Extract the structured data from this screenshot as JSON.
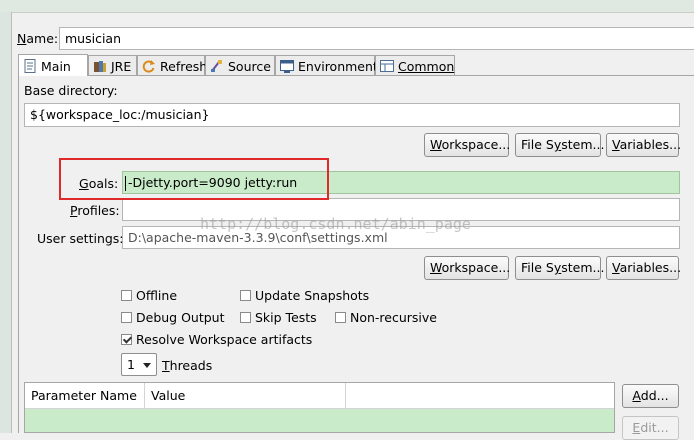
{
  "name_field": {
    "label": "Name:",
    "label_mnemonic": "N",
    "value": "musician"
  },
  "tabs": [
    {
      "label": "Main",
      "icon": "main-document-icon",
      "active": true
    },
    {
      "label": "JRE",
      "icon": "jre-library-icon"
    },
    {
      "label": "Refresh",
      "icon": "refresh-icon"
    },
    {
      "label": "Source",
      "icon": "source-icon"
    },
    {
      "label": "Environment",
      "icon": "environment-icon"
    },
    {
      "label": "Common",
      "icon": "common-icon"
    }
  ],
  "base_directory": {
    "label": "Base directory:",
    "value": "${workspace_loc:/musician}",
    "buttons": {
      "workspace": "Workspace...",
      "file_system": "File System...",
      "variables": "Variables..."
    }
  },
  "goals": {
    "label": "Goals:",
    "value": "-Djetty.port=9090 jetty:run"
  },
  "profiles": {
    "label": "Profiles:",
    "value": ""
  },
  "user_settings": {
    "label": "User settings:",
    "value": "D:\\apache-maven-3.3.9\\conf\\settings.xml",
    "buttons": {
      "workspace": "Workspace...",
      "file_system": "File System...",
      "variables": "Variables..."
    }
  },
  "options": {
    "offline": {
      "label": "Offline",
      "checked": false
    },
    "update_snapshots": {
      "label": "Update Snapshots",
      "checked": false
    },
    "debug_output": {
      "label": "Debug Output",
      "checked": false
    },
    "skip_tests": {
      "label": "Skip Tests",
      "checked": false
    },
    "non_recursive": {
      "label": "Non-recursive",
      "checked": false
    },
    "resolve_workspace": {
      "label": "Resolve Workspace artifacts",
      "checked": true
    }
  },
  "threads": {
    "value": "1",
    "label": "Threads"
  },
  "parameters_table": {
    "columns": [
      "Parameter Name",
      "Value"
    ],
    "buttons": {
      "add": "Add...",
      "edit": "Edit..."
    }
  },
  "watermark": "http://blog.csdn.net/abin_page",
  "colors": {
    "field_highlight": "#c9ebc9",
    "annotation_box": "#e02a2a"
  }
}
